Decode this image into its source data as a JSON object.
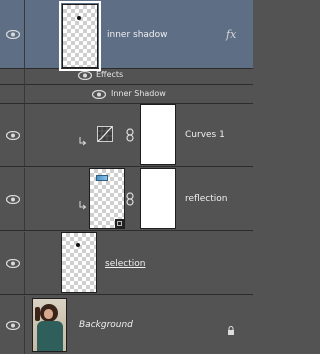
{
  "layers": [
    {
      "name": "inner shadow",
      "fx": "fx",
      "selected": true
    },
    {
      "name": "Curves 1"
    },
    {
      "name": "reflection"
    },
    {
      "name": "selection"
    },
    {
      "name": "Background"
    }
  ],
  "effects": {
    "label": "Effects",
    "items": [
      "Inner Shadow"
    ]
  },
  "icons": [
    "eye-icon",
    "chain-link-icon",
    "clipping-arrow-icon",
    "curves-adjustment-icon",
    "lock-icon",
    "fx-icon"
  ],
  "colors": {
    "panel": "#535353",
    "selected": "#5d6e85",
    "text": "#f0f0f0"
  }
}
